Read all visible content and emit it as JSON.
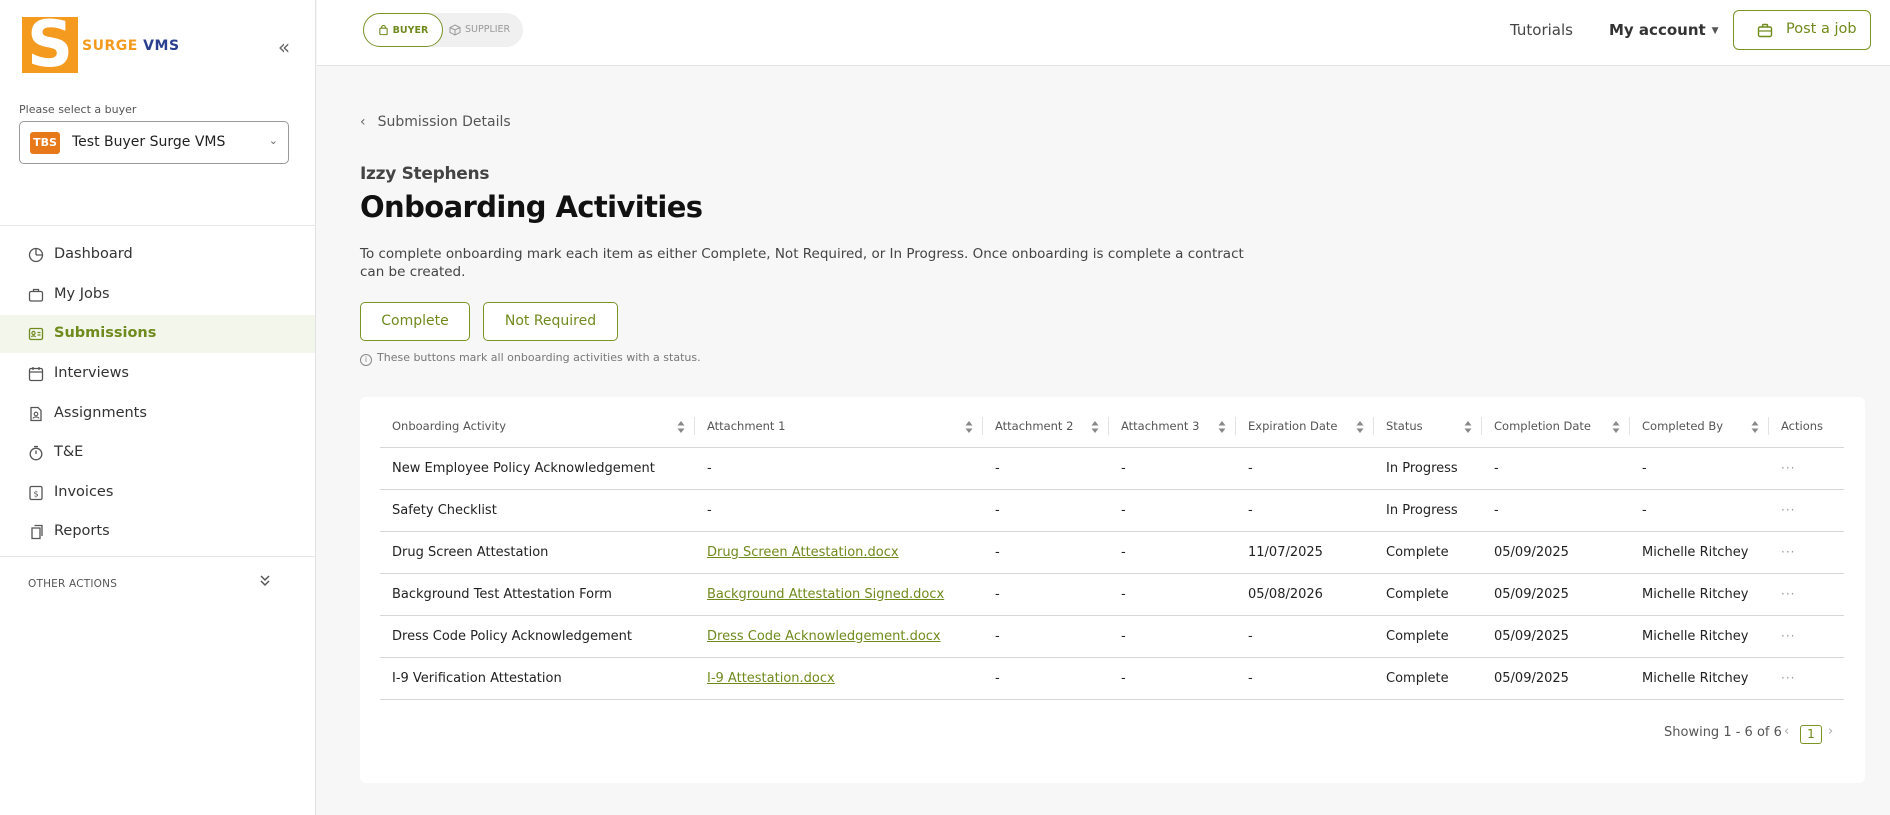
{
  "brand": {
    "logo_letter": "S",
    "word1": "SURGE",
    "word2": "VMS",
    "orange": "#f39a1f",
    "navy": "#2a3f8f"
  },
  "sidebar": {
    "buyer_label": "Please select a buyer",
    "buyer_badge": "TBS",
    "buyer_name": "Test Buyer Surge VMS",
    "items": [
      {
        "label": "Dashboard",
        "icon": "dashboard-icon"
      },
      {
        "label": "My Jobs",
        "icon": "briefcase-icon"
      },
      {
        "label": "Submissions",
        "icon": "id-card-icon",
        "active": true
      },
      {
        "label": "Interviews",
        "icon": "calendar-icon"
      },
      {
        "label": "Assignments",
        "icon": "assignment-icon"
      },
      {
        "label": "T&E",
        "icon": "stopwatch-icon"
      },
      {
        "label": "Invoices",
        "icon": "invoice-icon"
      },
      {
        "label": "Reports",
        "icon": "reports-icon"
      }
    ],
    "other_actions": "OTHER ACTIONS"
  },
  "header": {
    "toggle_buyer": "BUYER",
    "toggle_supplier": "SUPPLIER",
    "tutorials": "Tutorials",
    "my_account": "My account",
    "post_job": "Post a job"
  },
  "main": {
    "back_label": "Submission Details",
    "person_name": "Izzy Stephens",
    "title": "Onboarding Activities",
    "description": "To complete onboarding mark each item as either Complete, Not Required, or In Progress. Once onboarding is complete a contract can be created.",
    "btn_complete": "Complete",
    "btn_not_required": "Not Required",
    "hint": "These buttons mark all onboarding activities with a status.",
    "accent": "#6f8a1d"
  },
  "table": {
    "headers": [
      "Onboarding Activity",
      "Attachment 1",
      "Attachment 2",
      "Attachment 3",
      "Expiration Date",
      "Status",
      "Completion Date",
      "Completed By",
      "Actions"
    ],
    "rows": [
      [
        "New Employee Policy Acknowledgement",
        "-",
        "-",
        "-",
        "-",
        "In Progress",
        "-",
        "-",
        "···"
      ],
      [
        "Safety Checklist",
        "-",
        "-",
        "-",
        "-",
        "In Progress",
        "-",
        "-",
        "···"
      ],
      [
        "Drug Screen Attestation",
        "Drug Screen Attestation.docx",
        "-",
        "-",
        "11/07/2025",
        "Complete",
        "05/09/2025",
        "Michelle Ritchey",
        "···"
      ],
      [
        "Background Test Attestation Form",
        "Background Attestation Signed.docx",
        "-",
        "-",
        "05/08/2026",
        "Complete",
        "05/09/2025",
        "Michelle Ritchey",
        "···"
      ],
      [
        "Dress Code Policy Acknowledgement",
        "Dress Code Acknowledgement.docx",
        "-",
        "-",
        "-",
        "Complete",
        "05/09/2025",
        "Michelle Ritchey",
        "···"
      ],
      [
        "I-9 Verification Attestation",
        "I-9 Attestation.docx",
        "-",
        "-",
        "-",
        "Complete",
        "05/09/2025",
        "Michelle Ritchey",
        "···"
      ]
    ],
    "pager_text": "Showing 1 - 6 of 6",
    "current_page": "1"
  }
}
